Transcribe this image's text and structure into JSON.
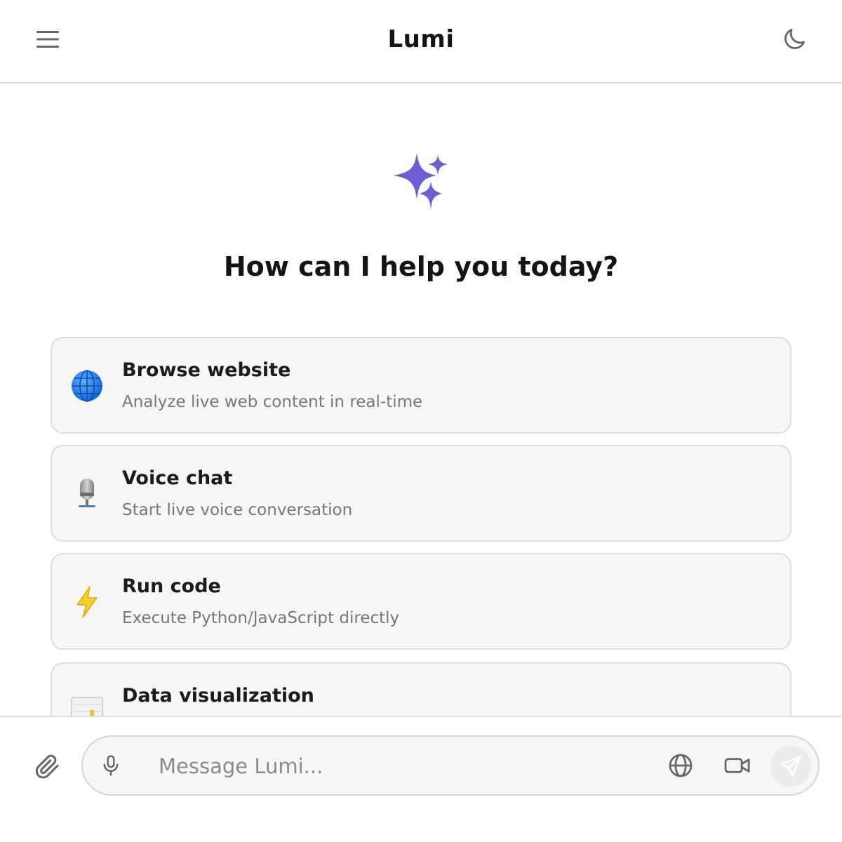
{
  "header": {
    "title": "Lumi",
    "menu_icon": "hamburger-menu-icon",
    "theme_icon": "moon-icon"
  },
  "hero": {
    "icon": "sparkles-icon",
    "headline": "How can I help you today?",
    "accent_color": "#6b5fd3"
  },
  "cards": [
    {
      "icon": "globe-icon",
      "title": "Browse website",
      "description": "Analyze live web content in real-time"
    },
    {
      "icon": "microphone-icon",
      "title": "Voice chat",
      "description": "Start live voice conversation"
    },
    {
      "icon": "lightning-icon",
      "title": "Run code",
      "description": "Execute Python/JavaScript directly"
    },
    {
      "icon": "bar-chart-icon",
      "title": "Data visualization",
      "description": ""
    }
  ],
  "composer": {
    "placeholder": "Message Lumi...",
    "attach_icon": "paperclip-icon",
    "mic_icon": "microphone-icon",
    "web_icon": "globe-icon",
    "video_icon": "video-camera-icon",
    "send_icon": "send-icon"
  }
}
